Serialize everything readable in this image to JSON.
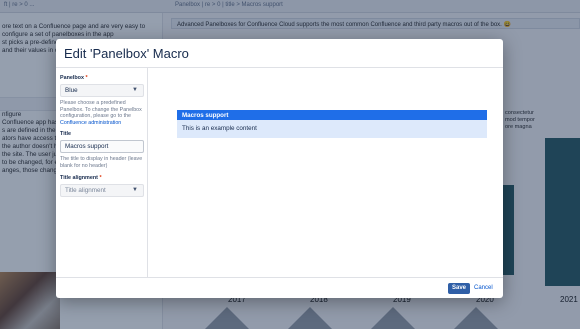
{
  "background": {
    "crumb_left": "ft | re > 0 ...",
    "crumb_right": "Panelbox | re > 0 | title > Macros support",
    "panel_line": "Advanced Panelboxes for Confluence Cloud supports the most common Confluence and third party macros out of the box. 😀",
    "left_lines": [
      "ore text on a Confluence page and are very easy to",
      "configure a set of panelboxes in the app",
      "st picks a pre-defined",
      "and their values in c"
    ],
    "left_lines2": [
      "nfigure",
      "",
      "Confluence app has t",
      "",
      "s are defined in the s",
      "ators have access to t",
      "the author doesn't h",
      "",
      "the site. The user ju",
      "",
      "to be changed, for e",
      "anges, those change"
    ],
    "right_lines": [
      "consectetur",
      "mod tempor",
      "ore magna"
    ],
    "years": [
      "2017",
      "2018",
      "2019",
      "2020",
      "2021"
    ]
  },
  "modal": {
    "title": "Edit 'Panelbox' Macro",
    "panelbox_label": "Panelbox",
    "required_mark": "*",
    "panelbox_value": "Blue",
    "panelbox_help": "Please choose a predefined Panelbox. To change the Panelbox configuration, please go to the",
    "panelbox_help_link": "Confluence administration",
    "title_label": "Title",
    "title_value": "Macros support",
    "title_help": "The title to display in header (leave blank for no header)",
    "alignment_label": "Title alignment",
    "alignment_placeholder": "Title alignment",
    "preview": {
      "header": "Macros support",
      "content": "This is an example content"
    },
    "save_label": "Save",
    "cancel_label": "Cancel"
  },
  "icons": {
    "chevron": "chevron-down-icon"
  },
  "colors": {
    "panel_header": "#1f6ee8",
    "panel_body": "#dde9fb",
    "save_button": "#2f5fa7"
  }
}
